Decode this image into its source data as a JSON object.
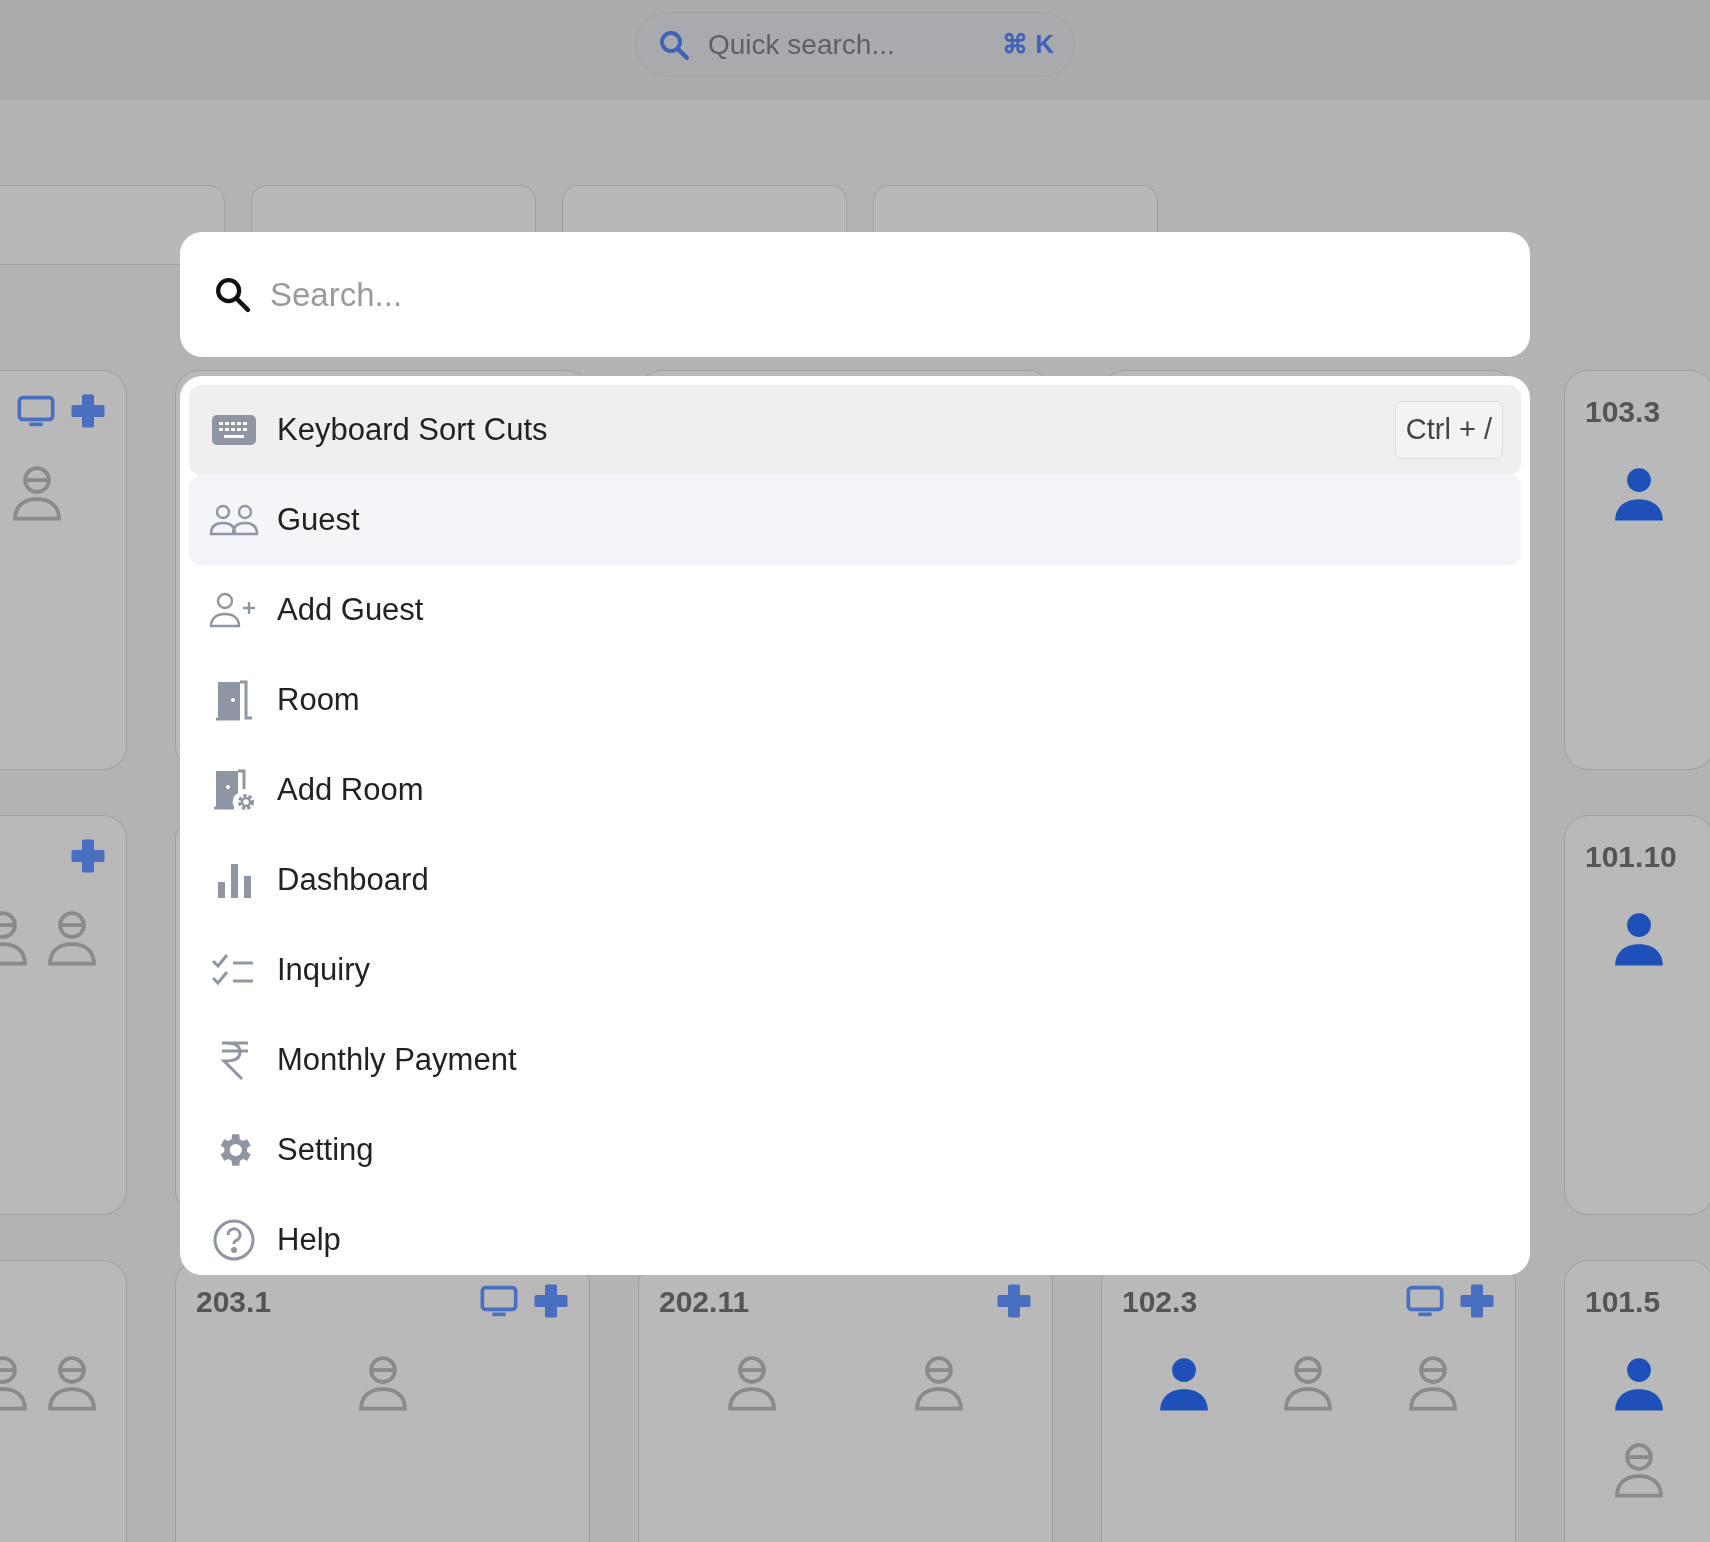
{
  "background": {
    "quick_search": {
      "placeholder": "Quick search...",
      "shortcut": "⌘ K"
    },
    "rows": [
      [
        {
          "tv": true,
          "plus": true,
          "beds": [
            {
              "occupied": false
            }
          ]
        },
        null,
        null,
        null,
        {
          "number": "103.3",
          "tv": false,
          "plus": false,
          "beds": [
            {
              "occupied": true
            }
          ]
        }
      ],
      [
        {
          "tv": false,
          "plus": true,
          "beds": [
            {
              "occupied": false
            },
            {
              "occupied": false
            }
          ]
        },
        null,
        null,
        null,
        {
          "number": "101.10",
          "tv": false,
          "plus": false,
          "beds": [
            {
              "occupied": true
            }
          ]
        }
      ],
      [
        {
          "tv": false,
          "plus": false,
          "beds": [
            {
              "occupied": false
            },
            {
              "occupied": false
            }
          ]
        },
        {
          "number": "203.1",
          "tv": true,
          "plus": true,
          "beds": [
            {
              "occupied": false
            }
          ]
        },
        {
          "number": "202.11",
          "tv": false,
          "plus": true,
          "beds": [
            {
              "occupied": false
            },
            {
              "occupied": false
            }
          ]
        },
        {
          "number": "102.3",
          "tv": true,
          "plus": true,
          "beds": [
            {
              "occupied": true
            },
            {
              "occupied": false
            },
            {
              "occupied": false
            }
          ]
        },
        {
          "number": "101.5",
          "tv": false,
          "plus": false,
          "beds": [
            {
              "occupied": true
            },
            {
              "occupied": false
            }
          ]
        }
      ]
    ]
  },
  "command_palette": {
    "search": {
      "placeholder": "Search..."
    },
    "items": [
      {
        "label": "Keyboard Sort Cuts",
        "shortcut": "Ctrl + /",
        "selected": true,
        "hovered": false
      },
      {
        "label": "Guest",
        "selected": false,
        "hovered": true
      },
      {
        "label": "Add Guest",
        "selected": false,
        "hovered": false
      },
      {
        "label": "Room",
        "selected": false,
        "hovered": false
      },
      {
        "label": "Add Room",
        "selected": false,
        "hovered": false
      },
      {
        "label": "Dashboard",
        "selected": false,
        "hovered": false
      },
      {
        "label": "Inquiry",
        "selected": false,
        "hovered": false
      },
      {
        "label": "Monthly Payment",
        "selected": false,
        "hovered": false
      },
      {
        "label": "Setting",
        "selected": false,
        "hovered": false
      },
      {
        "label": "Help",
        "selected": false,
        "hovered": false
      }
    ]
  }
}
